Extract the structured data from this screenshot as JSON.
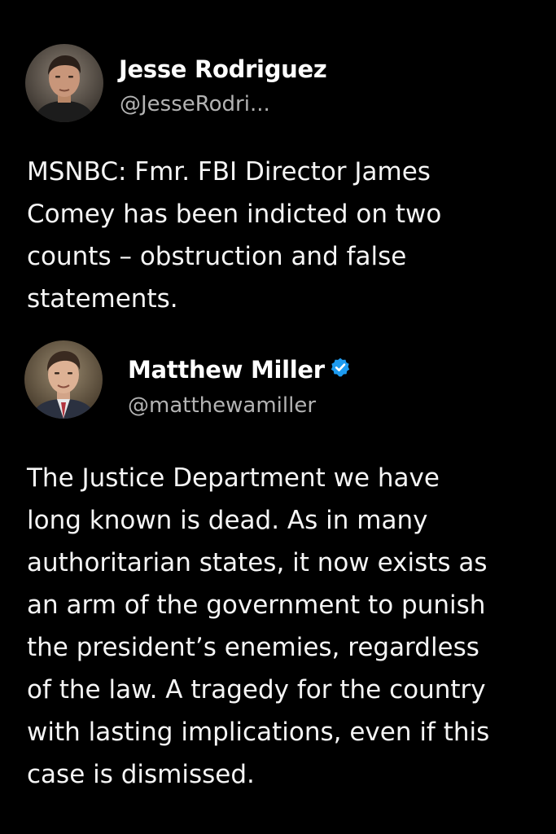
{
  "tweets": [
    {
      "display_name": "Jesse Rodriguez",
      "handle": "@JesseRodri...",
      "verified": false,
      "avatar": "profile-photo-man-dark-hair",
      "text": "MSNBC: Fmr. FBI Director James\nComey has been indicted on two\ncounts – obstruction and false\nstatements."
    },
    {
      "display_name": "Matthew Miller",
      "handle": "@matthewamiller",
      "verified": true,
      "verified_icon": "verified-badge-icon",
      "avatar": "profile-photo-man-suit",
      "text": "The Justice Department we have\nlong known is dead. As in many\nauthoritarian states, it now exists as\nan arm of the government to punish\nthe president’s enemies, regardless\nof the law. A tragedy for the country\nwith lasting implications, even if this\ncase is dismissed."
    }
  ],
  "colors": {
    "background": "#000000",
    "text": "#ffffff",
    "handle": "#b3b3b3",
    "verified": "#1d9bf0"
  }
}
